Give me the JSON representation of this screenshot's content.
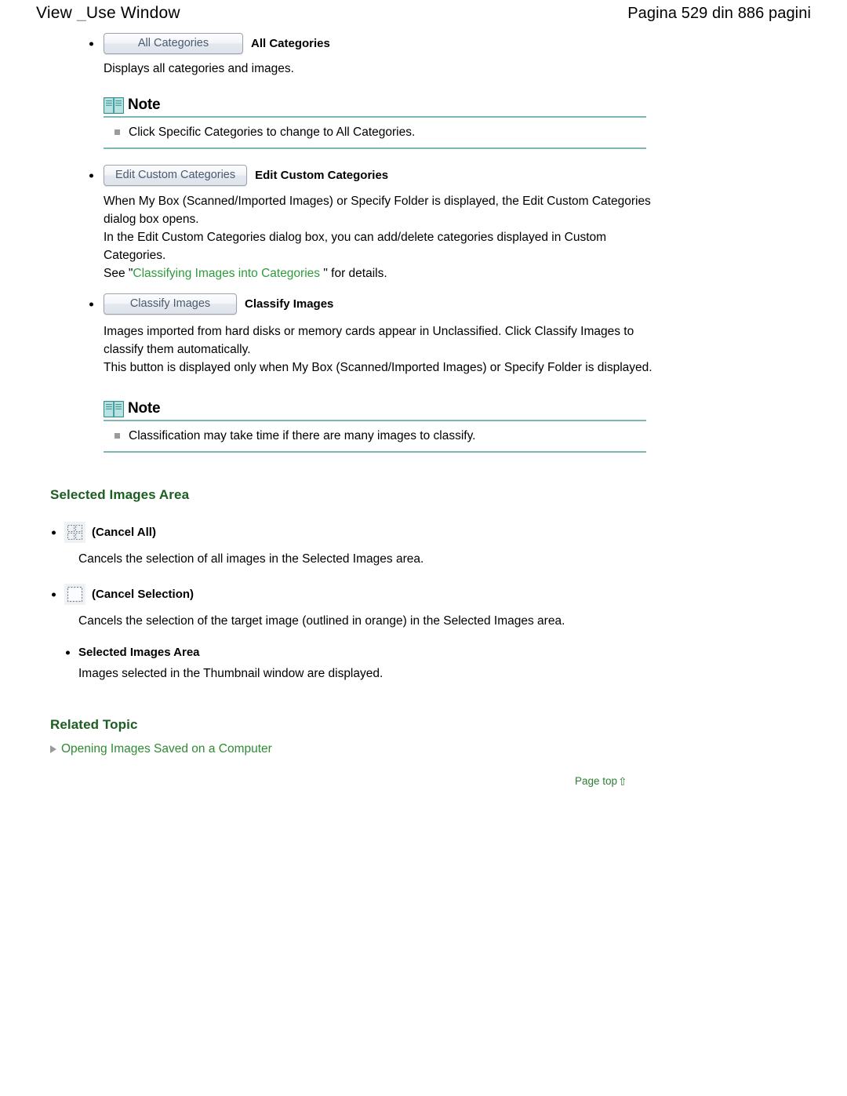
{
  "header": {
    "title_main": "View ",
    "title_underscore": "_",
    "title_rest": "Use Window",
    "page_info": "Pagina 529 din 886 pagini"
  },
  "colors": {
    "heading_green": "#1b5e20",
    "link_green": "#2e8b33",
    "note_rule_teal": "#7fb6b6",
    "note_bullet_gray": "#9b9b9b",
    "button_text": "#4a5a70"
  },
  "sections": {
    "all_categories": {
      "button_label": "All Categories",
      "bold_label": "All Categories",
      "description": "Displays all categories and images."
    },
    "note_1": {
      "icon": "book-icon",
      "title": "Note",
      "items": [
        "Click Specific Categories to change to All Categories."
      ]
    },
    "edit_custom_categories": {
      "button_label": "Edit Custom Categories",
      "bold_label": "Edit Custom Categories",
      "para_1": "When My Box (Scanned/Imported Images) or Specify Folder is displayed, the Edit Custom Categories dialog box opens.",
      "para_2": "In the Edit Custom Categories dialog box, you can add/delete categories displayed in Custom Categories.",
      "see_prefix": "See \"",
      "see_link": "Classifying Images into Categories",
      "see_suffix": " \" for details."
    },
    "classify_images": {
      "button_label": "Classify Images",
      "bold_label": "Classify Images",
      "para_1": "Images imported from hard disks or memory cards appear in Unclassified. Click Classify Images to classify them automatically.",
      "para_2": "This button is displayed only when My Box (Scanned/Imported Images) or Specify Folder is displayed."
    },
    "note_2": {
      "icon": "book-icon",
      "title": "Note",
      "items": [
        "Classification may take time if there are many images to classify."
      ]
    },
    "selected_images_area": {
      "heading": "Selected Images Area",
      "entries": [
        {
          "icon": "cancel-all-icon",
          "label": "(Cancel All)",
          "description": "Cancels the selection of all images in the Selected Images area."
        },
        {
          "icon": "cancel-selection-icon",
          "label": "(Cancel Selection)",
          "description": "Cancels the selection of the target image (outlined in orange) in the Selected Images area."
        },
        {
          "icon": null,
          "label": "Selected Images Area",
          "description": "Images selected in the Thumbnail window are displayed."
        }
      ]
    },
    "related_topic": {
      "heading": "Related Topic",
      "links": [
        "Opening Images Saved on a Computer"
      ]
    },
    "footer": {
      "page_top_label": "Page top",
      "page_top_arrow": "⇧"
    }
  }
}
